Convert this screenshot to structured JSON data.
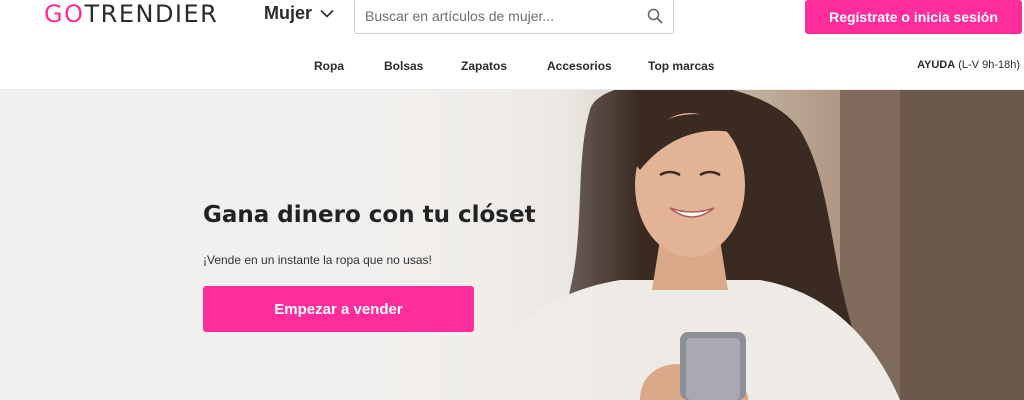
{
  "header": {
    "logo_go": "GO",
    "logo_rest": "TRENDIER",
    "gender_label": "Mujer",
    "search_placeholder": "Buscar en artículos de mujer...",
    "register_label": "Regístrate o inicia sesión"
  },
  "nav": {
    "items": [
      "Ropa",
      "Bolsas",
      "Zapatos",
      "Accesorios",
      "Top marcas"
    ],
    "help_label": "AYUDA",
    "help_hours": "(L-V 9h-18h)"
  },
  "hero": {
    "title": "Gana dinero con tu clóset",
    "subtitle": "¡Vende en un instante la ropa que no usas!",
    "cta_label": "Empezar a vender"
  },
  "colors": {
    "accent": "#ff2d9b",
    "text": "#2b2b2b"
  },
  "icons": {
    "search": "search-icon",
    "chevron": "chevron-down-icon"
  }
}
